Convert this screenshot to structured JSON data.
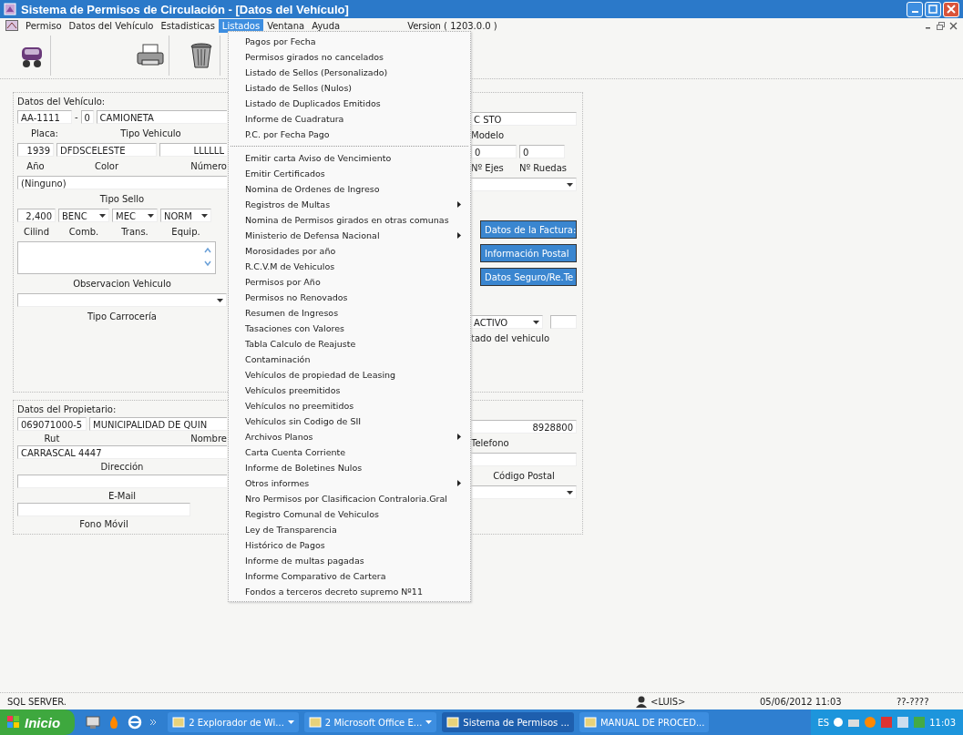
{
  "window": {
    "title": "Sistema de Permisos de Circulación - [Datos del Vehículo]"
  },
  "menu_bar": {
    "items": [
      {
        "label": "Permiso",
        "selected": false
      },
      {
        "label": "Datos del Vehículo",
        "selected": false
      },
      {
        "label": "Estadisticas",
        "selected": false
      },
      {
        "label": "Listados",
        "selected": true
      },
      {
        "label": "Ventana",
        "selected": false
      },
      {
        "label": "Ayuda",
        "selected": false
      }
    ],
    "version": "Version ( 1203.0.0 )"
  },
  "dropdown": {
    "groups": [
      [
        {
          "label": "Pagos por Fecha",
          "submenu": false
        },
        {
          "label": "Permisos girados no cancelados",
          "submenu": false
        },
        {
          "label": "Listado de Sellos (Personalizado)",
          "submenu": false
        },
        {
          "label": "Listado de Sellos (Nulos)",
          "submenu": false
        },
        {
          "label": "Listado de Duplicados Emitidos",
          "submenu": false
        },
        {
          "label": "Informe de Cuadratura",
          "submenu": false
        },
        {
          "label": "P.C. por Fecha Pago",
          "submenu": false
        }
      ],
      [
        {
          "label": "Emitir carta Aviso de Vencimiento",
          "submenu": false
        },
        {
          "label": "Emitir Certificados",
          "submenu": false
        },
        {
          "label": "Nomina de Ordenes de Ingreso",
          "submenu": false
        },
        {
          "label": "Registros de Multas",
          "submenu": true
        },
        {
          "label": "Nomina de Permisos girados en otras comunas",
          "submenu": false
        },
        {
          "label": "Ministerio de Defensa Nacional",
          "submenu": true
        },
        {
          "label": "Morosidades por año",
          "submenu": false
        },
        {
          "label": "R.C.V.M de Vehiculos",
          "submenu": false
        },
        {
          "label": "Permisos por Año",
          "submenu": false
        },
        {
          "label": "Permisos no Renovados",
          "submenu": false
        },
        {
          "label": "Resumen de Ingresos",
          "submenu": false
        },
        {
          "label": "Tasaciones con Valores",
          "submenu": false
        },
        {
          "label": "Tabla Calculo de Reajuste",
          "submenu": false
        },
        {
          "label": "Contaminación",
          "submenu": false
        },
        {
          "label": "Vehículos de propiedad de Leasing",
          "submenu": false
        },
        {
          "label": "Vehículos preemitidos",
          "submenu": false
        },
        {
          "label": "Vehículos no preemitidos",
          "submenu": false
        },
        {
          "label": "Vehículos sin Codigo de SII",
          "submenu": false
        },
        {
          "label": "Archivos Planos",
          "submenu": true
        },
        {
          "label": "Carta Cuenta Corriente",
          "submenu": false
        },
        {
          "label": "Informe de Boletines Nulos",
          "submenu": false
        },
        {
          "label": "Otros informes",
          "submenu": true
        },
        {
          "label": "Nro Permisos por Clasificacion Contraloria.Gral",
          "submenu": false
        },
        {
          "label": "Registro Comunal de Vehiculos",
          "submenu": false
        },
        {
          "label": "Ley de Transparencia",
          "submenu": false
        },
        {
          "label": "Histórico de Pagos",
          "submenu": false
        },
        {
          "label": "Informe de multas pagadas",
          "submenu": false
        },
        {
          "label": "Informe Comparativo de Cartera",
          "submenu": false
        },
        {
          "label": "Fondos a terceros decreto supremo Nº11",
          "submenu": false
        }
      ]
    ]
  },
  "vehicle": {
    "title": "Datos del Vehículo:",
    "placa": "AA-1111",
    "dash": "-",
    "dv": "0",
    "tipo": "CAMIONETA",
    "placa_label": "Placa:",
    "tipo_label": "Tipo Vehiculo",
    "anio": "1939",
    "paint": "DFDSCELESTE",
    "numero": "LLLLLL",
    "anio_label": "Año",
    "paint_label": "Color",
    "numero_label": "Número",
    "sello": "(Ninguno)",
    "sello_label": "Tipo Sello",
    "cilind": "2,400",
    "comb": "BENC",
    "trans": "MEC",
    "equip": "NORM",
    "cilind_label": "Cilind",
    "comb_label": "Comb.",
    "trans_label": "Trans.",
    "equip_label": "Equip.",
    "observacion_label": "Observacion Vehiculo",
    "carroceria_label": "Tipo Carrocería",
    "marca": "C STO",
    "modelo_label": "Modelo",
    "ejes": "0",
    "ruedas": "0",
    "ejes_label": "Nº Ejes",
    "ruedas_label": "Nº Ruedas",
    "buttons": [
      "Datos de la Factura:",
      "Información Postal",
      "Datos Seguro/Re.Te"
    ],
    "estado": "ACTIVO",
    "estado_label": "tado del vehiculo"
  },
  "owner": {
    "title": "Datos del Propietario:",
    "rut": "069071000-5",
    "nombre": "MUNICIPALIDAD DE QUIN",
    "rut_label": "Rut",
    "nombre_label": "Nombre",
    "direccion": "CARRASCAL 4447",
    "direccion_label": "Dirección",
    "email_label": "E-Mail",
    "movil_label": "Fono Móvil",
    "telefono": "8928800",
    "telefono_label": "Telefono",
    "postal_label": "Código Postal"
  },
  "status_bar": {
    "server": "SQL SERVER.",
    "user": "<LUIS>",
    "datetime": "05/06/2012  11:03",
    "code": "??-????"
  },
  "taskbar": {
    "start": "Inicio",
    "tasks": [
      {
        "label": "2 Explorador de Wi...",
        "grouped": true,
        "selected": false
      },
      {
        "label": "2 Microsoft Office E...",
        "grouped": true,
        "selected": false
      },
      {
        "label": "Sistema de Permisos ...",
        "grouped": false,
        "selected": true
      },
      {
        "label": "MANUAL DE PROCED...",
        "grouped": false,
        "selected": false
      }
    ],
    "language": "ES",
    "clock": "11:03"
  }
}
